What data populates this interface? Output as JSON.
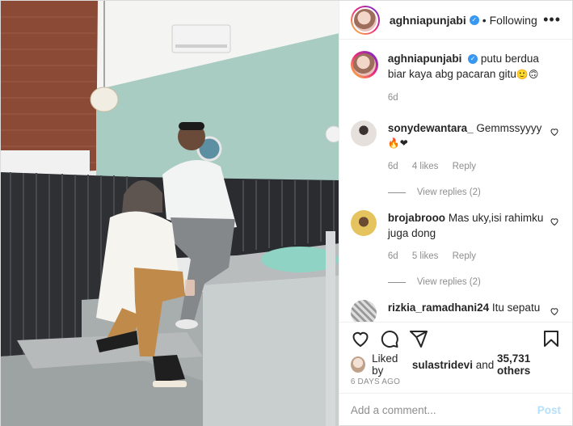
{
  "header": {
    "username": "aghniapunjabi",
    "separator": "•",
    "follow_state": "Following",
    "more": "•••"
  },
  "caption": {
    "username": "aghniapunjabi",
    "text": "putu berdua biar kaya abg pacaran gitu",
    "emoji": "🙂🙃",
    "time": "6d"
  },
  "comments": [
    {
      "username": "sonydewantara_",
      "text": "Gemmssyyyy",
      "emoji": "🔥❤",
      "time": "6d",
      "likes": "4 likes",
      "reply": "Reply",
      "view_replies": "View replies (2)"
    },
    {
      "username": "brojabrooo",
      "text": "Mas uky,isi rahimku juga dong",
      "time": "6d",
      "likes": "5 likes",
      "reply": "Reply",
      "view_replies": "View replies (2)"
    },
    {
      "username": "rizkia_ramadhani24",
      "text": "Itu sepatu"
    }
  ],
  "likes": {
    "prefix": "Liked by",
    "user": "sulastridevi",
    "middle": "and",
    "count": "35,731 others"
  },
  "posted_ago": "6 DAYS AGO",
  "add_comment": {
    "placeholder": "Add a comment...",
    "post_label": "Post"
  },
  "colors": {
    "verified": "#3897f0",
    "post_disabled": "#b2dffc",
    "muted": "#8e8e8e",
    "wall_mint": "#a8cbc2",
    "brick": "#8a4a36"
  },
  "icons": [
    "heart-icon",
    "comment-icon",
    "share-icon",
    "bookmark-icon",
    "verified-icon",
    "more-icon"
  ]
}
